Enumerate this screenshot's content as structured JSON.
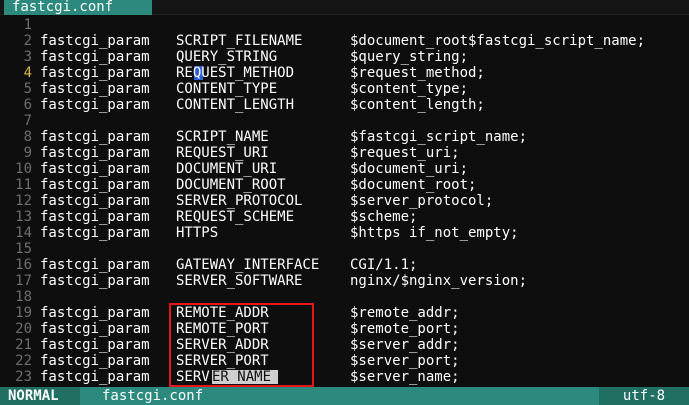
{
  "tab": {
    "title": "fastcgi.conf"
  },
  "buffer": {
    "lines": [
      {
        "num": "1",
        "c1": "",
        "c2": "",
        "c3": ""
      },
      {
        "num": "2",
        "c1": "fastcgi_param",
        "c2": "SCRIPT_FILENAME",
        "c3": "$document_root$fastcgi_script_name;"
      },
      {
        "num": "3",
        "c1": "fastcgi_param",
        "c2": "QUERY_STRING",
        "c3": "$query_string;"
      },
      {
        "num": "4",
        "c1": "fastcgi_param",
        "c2": "REQUEST_METHOD",
        "c3": "$request_method;"
      },
      {
        "num": "5",
        "c1": "fastcgi_param",
        "c2": "CONTENT_TYPE",
        "c3": "$content_type;"
      },
      {
        "num": "6",
        "c1": "fastcgi_param",
        "c2": "CONTENT_LENGTH",
        "c3": "$content_length;"
      },
      {
        "num": "7",
        "c1": "",
        "c2": "",
        "c3": ""
      },
      {
        "num": "8",
        "c1": "fastcgi_param",
        "c2": "SCRIPT_NAME",
        "c3": "$fastcgi_script_name;"
      },
      {
        "num": "9",
        "c1": "fastcgi_param",
        "c2": "REQUEST_URI",
        "c3": "$request_uri;"
      },
      {
        "num": "10",
        "c1": "fastcgi_param",
        "c2": "DOCUMENT_URI",
        "c3": "$document_uri;"
      },
      {
        "num": "11",
        "c1": "fastcgi_param",
        "c2": "DOCUMENT_ROOT",
        "c3": "$document_root;"
      },
      {
        "num": "12",
        "c1": "fastcgi_param",
        "c2": "SERVER_PROTOCOL",
        "c3": "$server_protocol;"
      },
      {
        "num": "13",
        "c1": "fastcgi_param",
        "c2": "REQUEST_SCHEME",
        "c3": "$scheme;"
      },
      {
        "num": "14",
        "c1": "fastcgi_param",
        "c2": "HTTPS",
        "c3": "$https if_not_empty;"
      },
      {
        "num": "15",
        "c1": "",
        "c2": "",
        "c3": ""
      },
      {
        "num": "16",
        "c1": "fastcgi_param",
        "c2": "GATEWAY_INTERFACE",
        "c3": "CGI/1.1;"
      },
      {
        "num": "17",
        "c1": "fastcgi_param",
        "c2": "SERVER_SOFTWARE",
        "c3": "nginx/$nginx_version;"
      },
      {
        "num": "18",
        "c1": "",
        "c2": "",
        "c3": ""
      },
      {
        "num": "19",
        "c1": "fastcgi_param",
        "c2": "REMOTE_ADDR",
        "c3": "$remote_addr;"
      },
      {
        "num": "20",
        "c1": "fastcgi_param",
        "c2": "REMOTE_PORT",
        "c3": "$remote_port;"
      },
      {
        "num": "21",
        "c1": "fastcgi_param",
        "c2": "SERVER_ADDR",
        "c3": "$server_addr;"
      },
      {
        "num": "22",
        "c1": "fastcgi_param",
        "c2": "SERVER_PORT",
        "c3": "$server_port;"
      },
      {
        "num": "23",
        "c1": "fastcgi_param",
        "c2": "SERVER_NAME",
        "c3": "$server_name;"
      }
    ],
    "current_line": "4",
    "line_23_split": {
      "before": "SERV",
      "selected": "ER_NAME"
    }
  },
  "statusline": {
    "mode": "NORMAL",
    "filename": "fastcgi.conf",
    "encoding": "utf-8"
  },
  "colors": {
    "tab_bg": "#2b8a7d",
    "status_bg": "#2b8a7d",
    "mode_bg": "#1f6f63",
    "cursor": "#2f5dd6",
    "highlight_box": "#e5161b",
    "line_number": "#6e6e6e",
    "current_line_number": "#e0b54a"
  }
}
